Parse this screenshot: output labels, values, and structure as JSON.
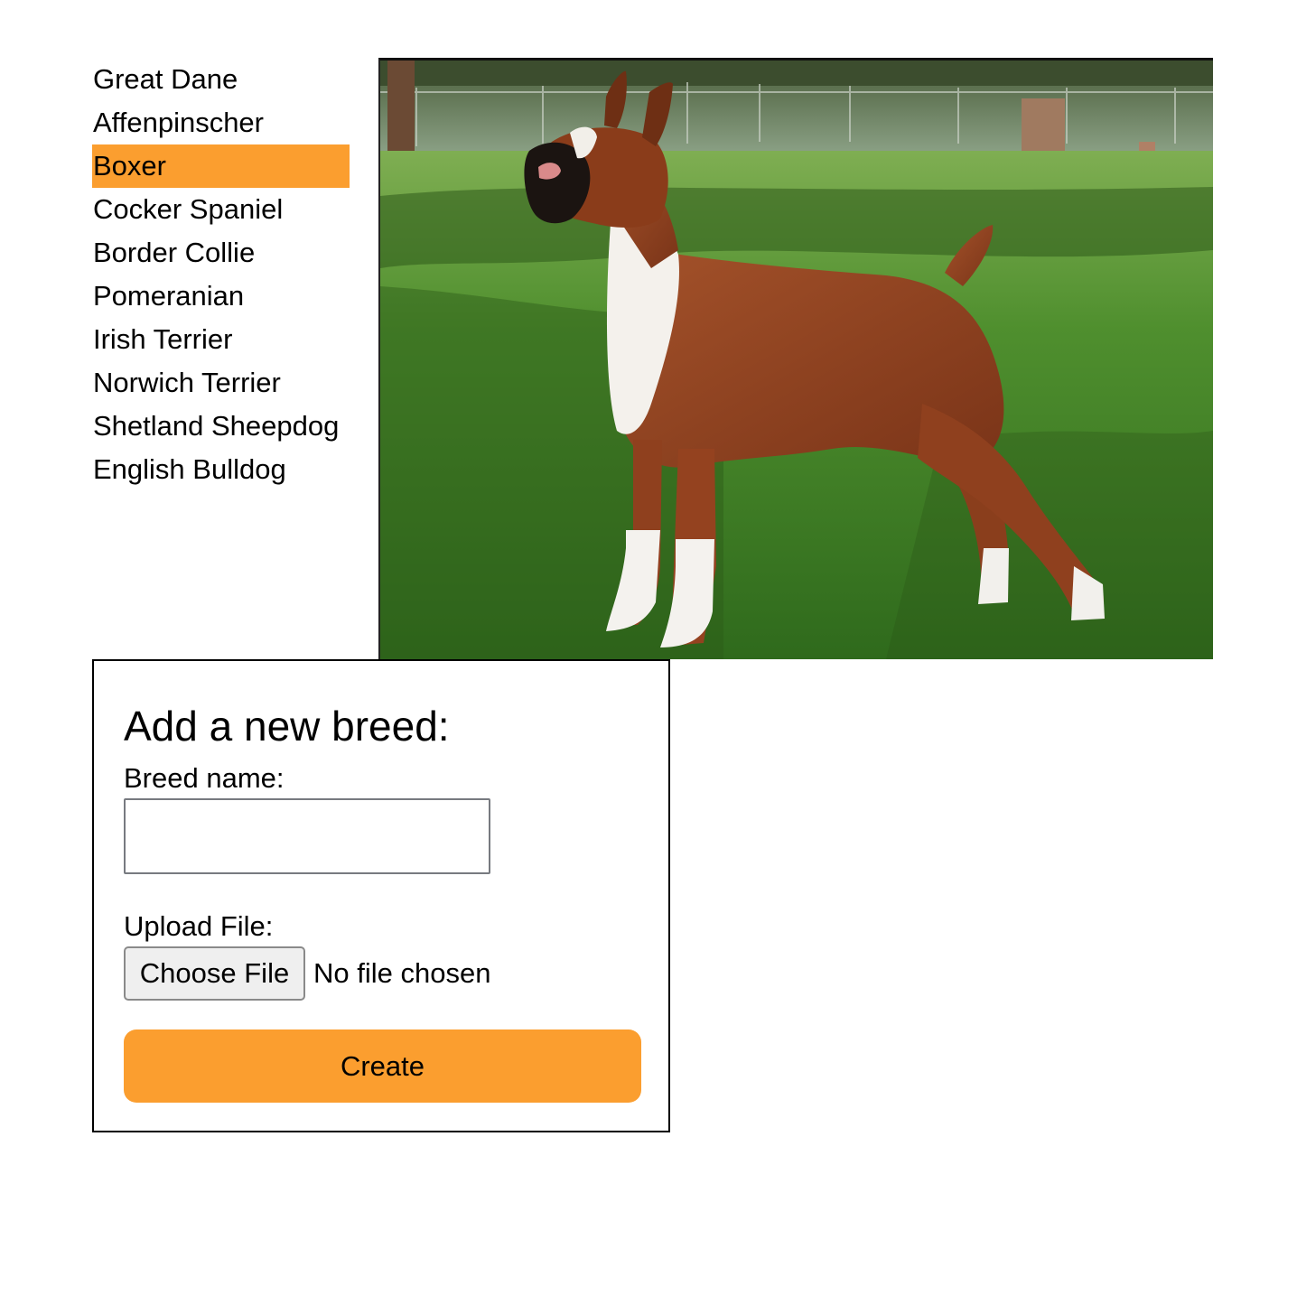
{
  "breeds": [
    {
      "label": "Great Dane",
      "selected": false
    },
    {
      "label": "Affenpinscher",
      "selected": false
    },
    {
      "label": "Boxer",
      "selected": true
    },
    {
      "label": "Cocker Spaniel",
      "selected": false
    },
    {
      "label": "Border Collie",
      "selected": false
    },
    {
      "label": "Pomeranian",
      "selected": false
    },
    {
      "label": "Irish Terrier",
      "selected": false
    },
    {
      "label": "Norwich Terrier",
      "selected": false
    },
    {
      "label": "Shetland Sheepdog",
      "selected": false
    },
    {
      "label": "English Bulldog",
      "selected": false
    }
  ],
  "photo": {
    "subject": "boxer-dog-photo"
  },
  "form": {
    "title": "Add a new breed:",
    "breed_name_label": "Breed name:",
    "breed_name_value": "",
    "breed_name_placeholder": "",
    "upload_label": "Upload File:",
    "choose_file_label": "Choose File",
    "file_status": "No file chosen",
    "create_label": "Create"
  },
  "colors": {
    "accent": "#FB9E2F",
    "input_border": "#777a80",
    "file_button_bg": "#efefef"
  }
}
